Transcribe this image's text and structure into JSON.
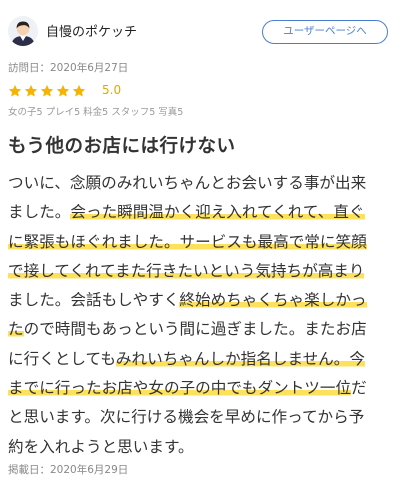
{
  "user": {
    "name": "自慢のポケッチ",
    "profile_button_label": "ユーザーページへ"
  },
  "review": {
    "visit_date": "訪問日：2020年6月27日",
    "rating": 5.0,
    "rating_text": "5.0",
    "stars_filled": 5,
    "stars_total": 5,
    "sub_ratings": "女の子5 プレイ5 料金5 スタッフ5 写真5",
    "title": "もう他のお店には行けない",
    "posted_date": "掲載日：2020年6月29日",
    "highlight_color": "#fde15c",
    "star_color": "#f4b400",
    "body_lines": [
      [
        {
          "t": "ついに、念願のみれいちゃんとお会いする事が出来",
          "h": false
        }
      ],
      [
        {
          "t": "ました。",
          "h": false
        },
        {
          "t": "会った瞬間温かく迎え入れてくれて、直ぐ",
          "h": true
        }
      ],
      [
        {
          "t": "に緊張もほぐれました。",
          "h": true
        },
        {
          "t": "サービスも最高で常に笑顔",
          "h": true
        }
      ],
      [
        {
          "t": "で接してくれてまた行きたいという気持ちが高まり",
          "h": true
        }
      ],
      [
        {
          "t": "ました。会話もしやすく",
          "h": false
        },
        {
          "t": "終始めちゃくちゃ楽しかっ",
          "h": true
        }
      ],
      [
        {
          "t": "た",
          "h": true
        },
        {
          "t": "ので時間もあっという間に過ぎました。またお店",
          "h": false
        }
      ],
      [
        {
          "t": "に行くとしても",
          "h": false
        },
        {
          "t": "みれいちゃんしか指名しません。今",
          "h": true
        }
      ],
      [
        {
          "t": "までに行ったお店や女の子の中でもダントツ一位",
          "h": true
        },
        {
          "t": "だ",
          "h": false
        }
      ],
      [
        {
          "t": "と思います。次に行ける機会を早めに作ってから予",
          "h": false
        }
      ],
      [
        {
          "t": "約を入れようと思います。",
          "h": false
        }
      ]
    ]
  }
}
